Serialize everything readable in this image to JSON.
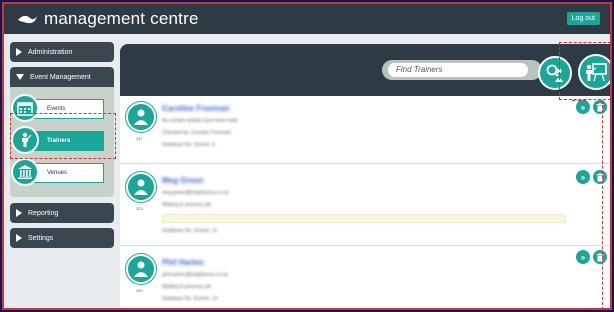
{
  "header": {
    "app_title": "management centre",
    "logout_label": "Log out",
    "logo_icon": "swoosh-logo-icon"
  },
  "sidebar": {
    "administration": "Administration",
    "event_management": "Event Management",
    "sub_items": [
      {
        "label": "Events",
        "icon": "calendar-icon"
      },
      {
        "label": "Trainers",
        "icon": "trainer-icon"
      },
      {
        "label": "Venues",
        "icon": "building-icon"
      }
    ],
    "reporting": "Reporting",
    "settings": "Settings"
  },
  "search": {
    "placeholder": "Find Trainers"
  },
  "trainers": [
    {
      "id": "347",
      "name": "Caroline Freeman",
      "line1": "No contact details have been held",
      "line2": "Checked by: Caroline Freeman",
      "line3": "Database No. Events: 6",
      "highlight": false
    },
    {
      "id": "323",
      "name": "Meg Green",
      "line1": "meg.green@brightsmos.co.uk",
      "line2": "Waiting to process job",
      "line3": "Database No. Events: 11",
      "highlight": true
    },
    {
      "id": "330",
      "name": "Phil Harlen",
      "line1": "phil.harlen@brightsmos.co.uk",
      "line2": "Waiting to process job",
      "line3": "Database No. Events: 14",
      "highlight": false
    }
  ],
  "colors": {
    "accent": "#1aa79a",
    "dark": "#2e3a44",
    "annotation": "#d2332b"
  }
}
